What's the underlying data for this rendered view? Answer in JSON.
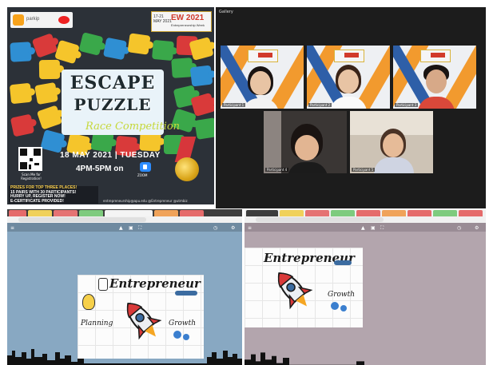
{
  "poster": {
    "logo_text": "parkip",
    "ew_days": "17-21\nMAY 2021",
    "ew_title": "EW 2021",
    "ew_sub": "Entrepreneurship Week",
    "title_line1": "ESCAPE",
    "title_line2": "PUZZLE",
    "title_line3": "Race Competition",
    "qr_caption": "Scan Me for Registration!",
    "date": "18 MAY 2021 | TUESDAY",
    "time": "4PM-5PM on",
    "zoom_caption": "ZOOM",
    "prize_lines": [
      "PRIZES FOR TOP THREE PLACES!",
      "15 PAIRS WITH 30 PARTICIPANTS!",
      "HURRY UP, REGISTER NOW!",
      "E-CERTIFICATE PROVIDED!"
    ],
    "contact": "entrepreneurship@apu.edu   @Entrepreneur   @utmbiz",
    "colors": {
      "red": "#d93a3a",
      "yellow": "#f5c52b",
      "green": "#3aa84a",
      "blue": "#2f8fd3",
      "navy": "#2c3138"
    }
  },
  "zoom": {
    "window_label": "Gallery",
    "participants": [
      {
        "name": "Participant 1"
      },
      {
        "name": "Participant 2"
      },
      {
        "name": "Participant 3"
      },
      {
        "name": "Participant 4"
      },
      {
        "name": "Participant 5"
      }
    ]
  },
  "browser_left": {
    "title": "Entrepreneur",
    "label_planning": "Planning",
    "label_growth": "Growth"
  },
  "browser_right": {
    "title": "Entrepreneur",
    "label_growth": "Growth"
  }
}
